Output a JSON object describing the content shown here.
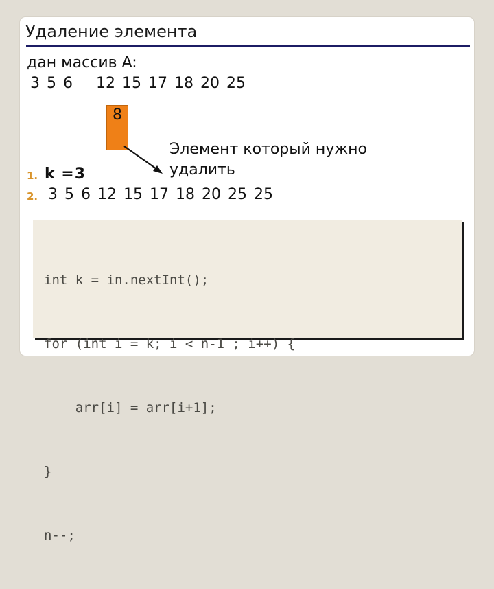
{
  "slide": {
    "title": "Удаление элемента",
    "background_color": "#e2ded5",
    "card_color": "#ffffff",
    "title_rule_color": "#1c1c64"
  },
  "body": {
    "given_array_label": "дан массив A:",
    "array_values": [
      "3",
      "5",
      "6",
      "8",
      "12",
      "15",
      "17",
      "18",
      "20",
      "25"
    ],
    "highlight": {
      "value": "8",
      "index": 3,
      "color": "#ef8017",
      "border_color": "#c0650c"
    },
    "note": "Элемент который нужно удалить"
  },
  "list": {
    "marker_color": "#d9942b",
    "items": [
      {
        "marker": "1.",
        "text": "k =3",
        "bold": true,
        "values": []
      },
      {
        "marker": "2.",
        "text": "",
        "bold": false,
        "values": [
          "3",
          "5",
          "6",
          "12",
          "15",
          "17",
          "18",
          "20",
          "25",
          "25"
        ]
      }
    ]
  },
  "code": {
    "background_color": "#f1ece1",
    "text_color": "#4b4a45",
    "lines": [
      "int k = in.nextInt();",
      "for (int i = k; i < n-1 ; i++) {",
      "    arr[i] = arr[i+1];",
      "}",
      "n--;"
    ]
  }
}
